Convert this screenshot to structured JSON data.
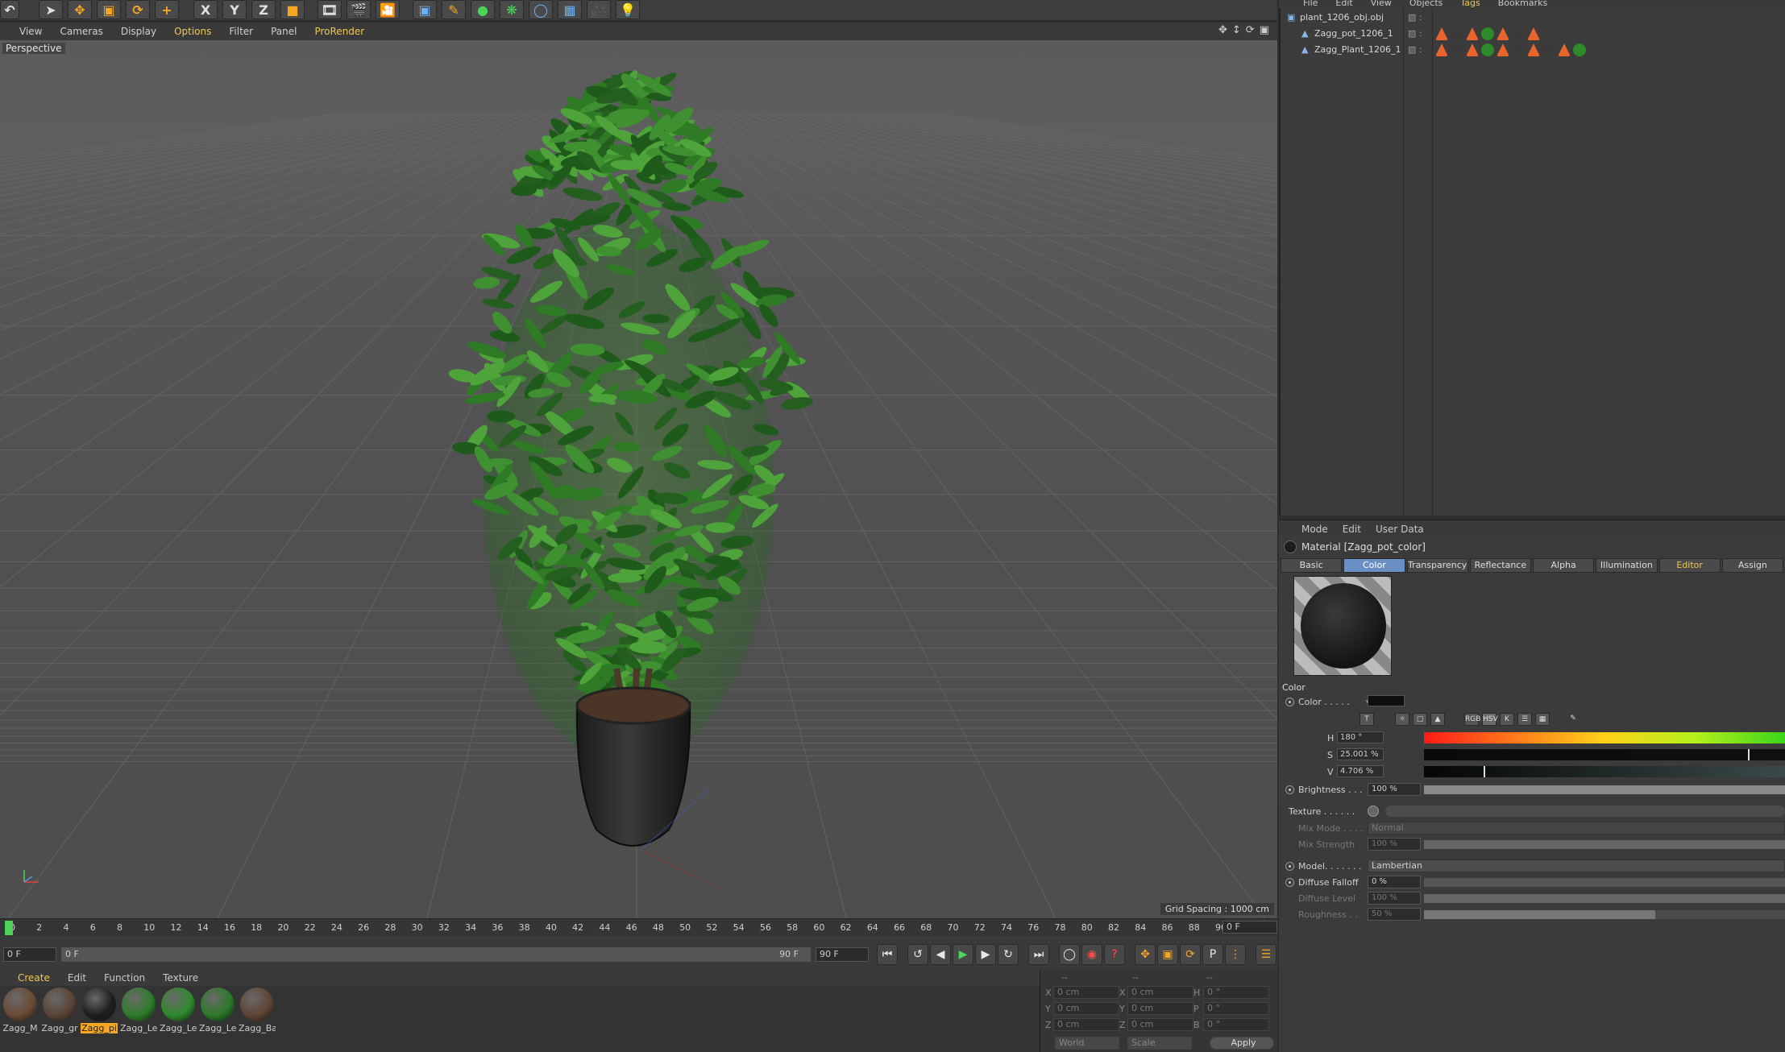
{
  "toolbar": {
    "icons": [
      "select-icon",
      "move-icon",
      "scale-icon",
      "rotate-icon",
      "add-icon",
      "x-axis-icon",
      "y-axis-icon",
      "z-axis-icon",
      "coord-system-icon",
      "render-view-icon",
      "render-picture-icon",
      "render-settings-icon",
      "cube-icon",
      "pen-icon",
      "nurbs-icon",
      "array-icon",
      "deformer-icon",
      "scene-icon",
      "camera-icon",
      "light-icon"
    ],
    "labels": {
      "x": "X",
      "y": "Y",
      "z": "Z"
    }
  },
  "viewport_menu": [
    "View",
    "Cameras",
    "Display",
    "Options",
    "Filter",
    "Panel",
    "ProRender"
  ],
  "viewport": {
    "label": "Perspective",
    "grid_spacing": "Grid Spacing : 1000 cm"
  },
  "timeline": {
    "ticks": [
      "0",
      "2",
      "4",
      "6",
      "8",
      "10",
      "12",
      "14",
      "16",
      "18",
      "20",
      "22",
      "24",
      "26",
      "28",
      "30",
      "32",
      "34",
      "36",
      "38",
      "40",
      "42",
      "44",
      "46",
      "48",
      "50",
      "52",
      "54",
      "56",
      "58",
      "60",
      "62",
      "64",
      "66",
      "68",
      "70",
      "72",
      "74",
      "76",
      "78",
      "80",
      "82",
      "84",
      "86",
      "88",
      "90"
    ],
    "current_frame": "0 F",
    "start_field": "0 F",
    "range_start": "0 F",
    "range_end": "90 F",
    "end_field": "90 F"
  },
  "material_menu": [
    "Create",
    "Edit",
    "Function",
    "Texture"
  ],
  "materials": [
    {
      "label": "Zagg_M",
      "color": "#6a4a34"
    },
    {
      "label": "Zagg_gr",
      "color": "#5a4434"
    },
    {
      "label": "Zagg_pi",
      "color": "#1e1e1e",
      "selected": true
    },
    {
      "label": "Zagg_Le",
      "color": "#2d7d2a"
    },
    {
      "label": "Zagg_Le",
      "color": "#2f8a2c"
    },
    {
      "label": "Zagg_Le",
      "color": "#2b7a28"
    },
    {
      "label": "Zagg_Ba",
      "color": "#5e4433"
    }
  ],
  "coordinates": {
    "header": [
      "--",
      "--",
      "--"
    ],
    "rows": [
      {
        "a": "X",
        "av": "0 cm",
        "b": "X",
        "bv": "0 cm",
        "c": "H",
        "cv": "0 °"
      },
      {
        "a": "Y",
        "av": "0 cm",
        "b": "Y",
        "bv": "0 cm",
        "c": "P",
        "cv": "0 °"
      },
      {
        "a": "Z",
        "av": "0 cm",
        "b": "Z",
        "bv": "0 cm",
        "c": "B",
        "cv": "0 °"
      }
    ],
    "world": "World",
    "scale": "Scale",
    "apply": "Apply"
  },
  "object_menu": [
    "File",
    "Edit",
    "View",
    "Objects",
    "Tags",
    "Bookmarks"
  ],
  "objects": [
    {
      "name": "plant_1206_obj.obj",
      "indent": 0
    },
    {
      "name": "Zagg_pot_1206_1",
      "indent": 1
    },
    {
      "name": "Zagg_Plant_1206_1",
      "indent": 1
    }
  ],
  "attribute_menu": [
    "Mode",
    "Edit",
    "User Data"
  ],
  "attributes": {
    "title": "Material [Zagg_pot_color]",
    "tabs": [
      "Basic",
      "Color",
      "Transparency",
      "Reflectance",
      "Alpha",
      "Illumination",
      "Editor",
      "Assign"
    ],
    "section": "Color",
    "color_label": "Color . . . . .",
    "hsv": {
      "h": "180 °",
      "s": "25.001 %",
      "v": "4.706 %",
      "h_key": "H",
      "s_key": "S",
      "v_key": "V"
    },
    "brightness_label": "Brightness . . .",
    "brightness": "100 %",
    "texture_label": "Texture . . . . . .",
    "mix_mode_label": "Mix Mode . . . .",
    "mix_mode": "Normal",
    "mix_strength_label": "Mix Strength",
    "mix_strength": "100 %",
    "model_label": "Model. . . . . . .",
    "model": "Lambertian",
    "diffuse_falloff_label": "Diffuse Falloff",
    "diffuse_falloff": "0 %",
    "diffuse_level_label": "Diffuse Level",
    "diffuse_level": "100 %",
    "roughness_label": "Roughness . .",
    "roughness": "50 %",
    "icons": [
      "texture-icon",
      "color-wheel-icon",
      "spectrum-icon",
      "picture-icon",
      "rgb-icon",
      "hsv-icon",
      "kelvin-icon",
      "mixer-icon",
      "swatch-icon",
      "eyedropper-icon"
    ]
  }
}
